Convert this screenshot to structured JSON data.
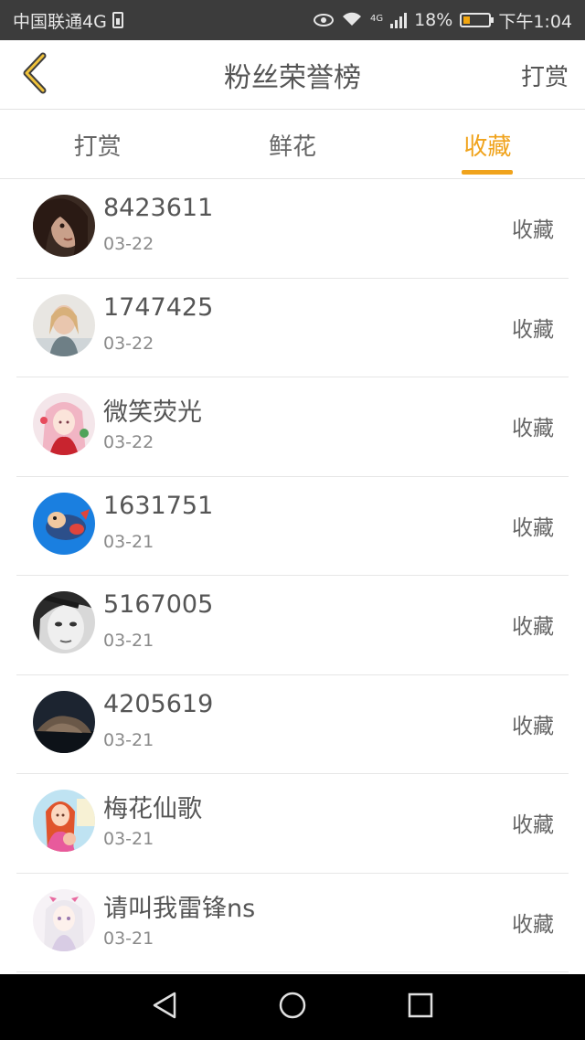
{
  "status_bar": {
    "carrier": "中国联通4G",
    "net_type": "4G",
    "battery": "18%",
    "battery_level": 0.18,
    "time": "下午1:04"
  },
  "header": {
    "title": "粉丝荣誉榜",
    "action_label": "打赏",
    "back_icon": "back-chevron-icon"
  },
  "tabs": [
    {
      "label": "打赏",
      "active": false
    },
    {
      "label": "鲜花",
      "active": false
    },
    {
      "label": "收藏",
      "active": true
    }
  ],
  "colors": {
    "accent": "#f0a31c",
    "status_bar_bg": "#3c3c3c",
    "nav_bar_bg": "#000000"
  },
  "fans": [
    {
      "name": "8423611",
      "date": "03-22",
      "action": "收藏",
      "avatar_icon": "avatar-woman-dark-hair"
    },
    {
      "name": "1747425",
      "date": "03-22",
      "action": "收藏",
      "avatar_icon": "avatar-woman-blonde"
    },
    {
      "name": "微笑荧光",
      "date": "03-22",
      "action": "收藏",
      "avatar_icon": "avatar-anime-girl-red"
    },
    {
      "name": "1631751",
      "date": "03-21",
      "action": "收藏",
      "avatar_icon": "avatar-cartoon-blue"
    },
    {
      "name": "5167005",
      "date": "03-21",
      "action": "收藏",
      "avatar_icon": "avatar-bw-portrait"
    },
    {
      "name": "4205619",
      "date": "03-21",
      "action": "收藏",
      "avatar_icon": "avatar-dark-scene"
    },
    {
      "name": "梅花仙歌",
      "date": "03-21",
      "action": "收藏",
      "avatar_icon": "avatar-cartoon-girl-pink"
    },
    {
      "name": "请叫我雷锋ns",
      "date": "03-21",
      "action": "收藏",
      "avatar_icon": "avatar-anime-white-hair"
    }
  ],
  "nav_bar": {
    "back_icon": "nav-back-icon",
    "home_icon": "nav-home-icon",
    "recents_icon": "nav-recents-icon"
  }
}
